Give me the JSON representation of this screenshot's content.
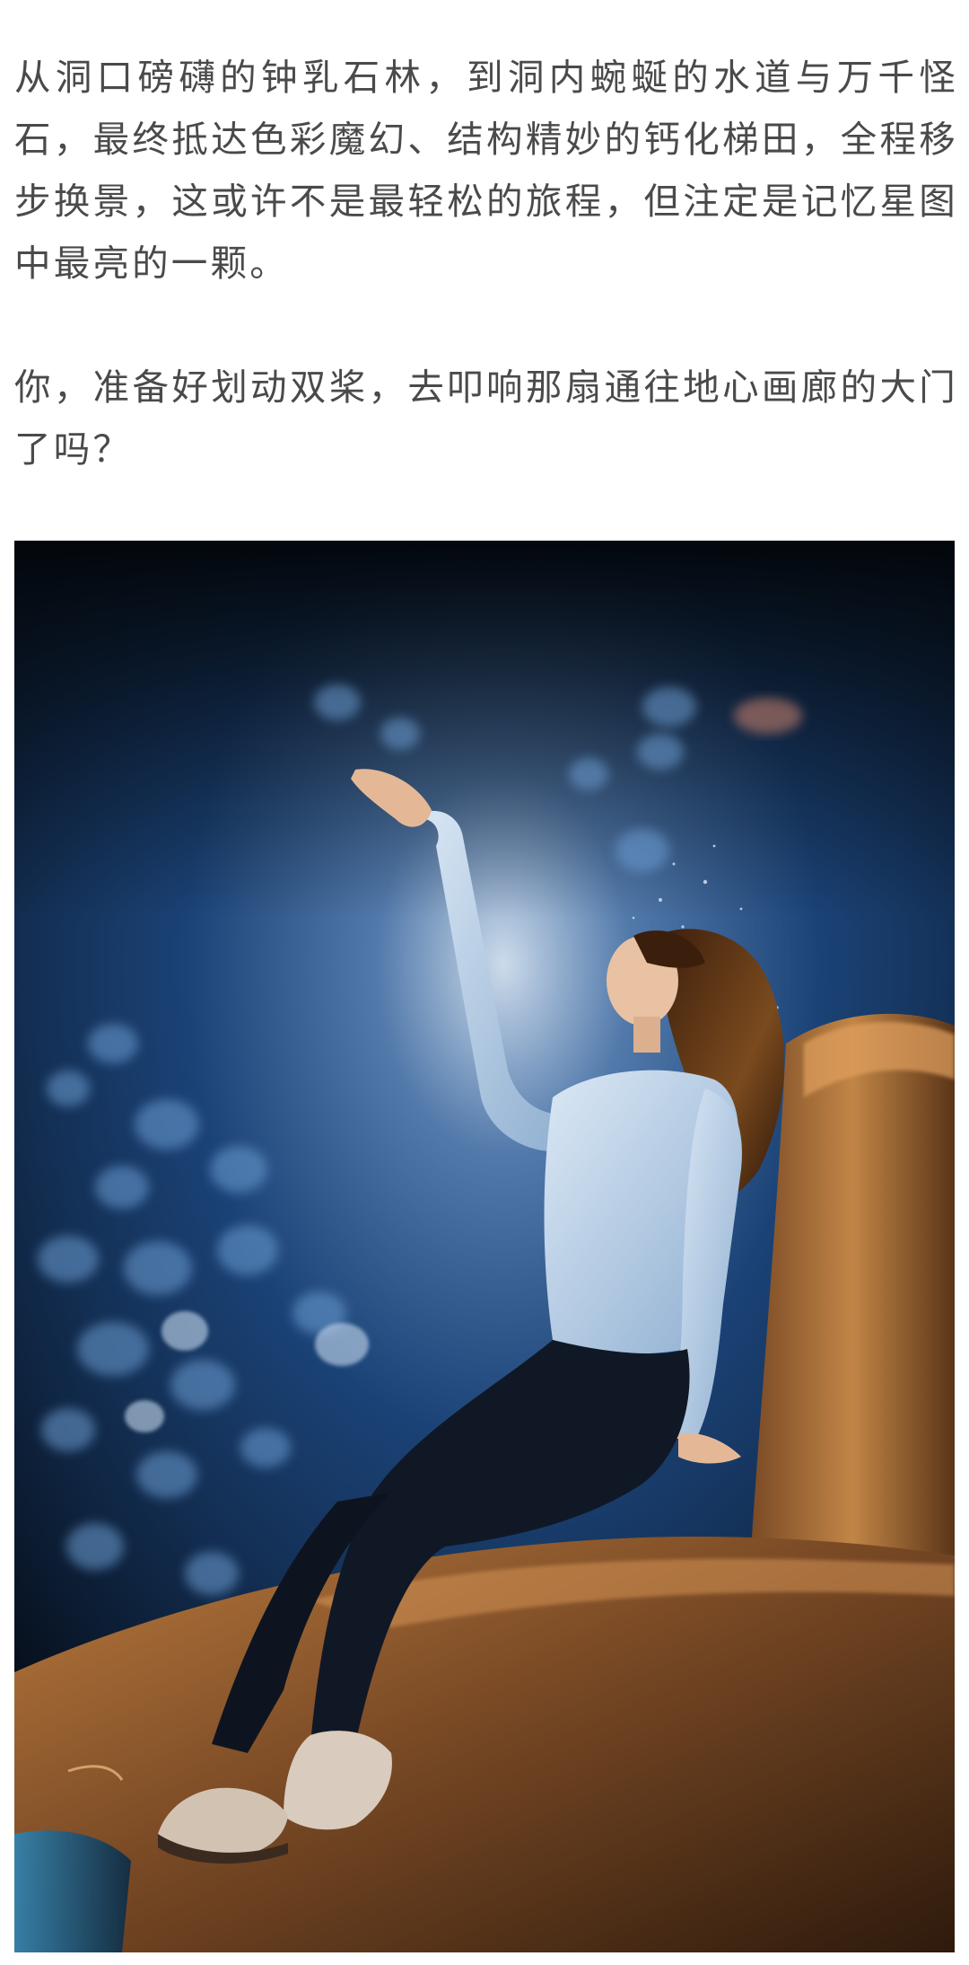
{
  "article": {
    "paragraph_1": "从洞口磅礴的钟乳石林，到洞内蜿蜒的水道与万千怪石，最终抵达色彩魔幻、结构精妙的钙化梯田，全程移步换景，这或许不是最轻松的旅程，但注定是记忆星图中最亮的一颗。",
    "paragraph_2": "你，准备好划动双桨，去叩响那扇通往地心画廊的大门了吗？"
  },
  "photo": {
    "subject": "woman in light blue long-sleeve top and dark pants sitting on an orange-lit rock inside a blue-lit cave, raising one hand toward falling water droplets",
    "colors": {
      "cave_dark": "#07101a",
      "cave_blue": "#1e4b86",
      "glow": "#d7e6f6",
      "rock": "#6b4020",
      "rock_highlight": "#b97a3e",
      "top": "#a9c4df",
      "pants": "#101826",
      "hair": "#2a1508"
    }
  }
}
